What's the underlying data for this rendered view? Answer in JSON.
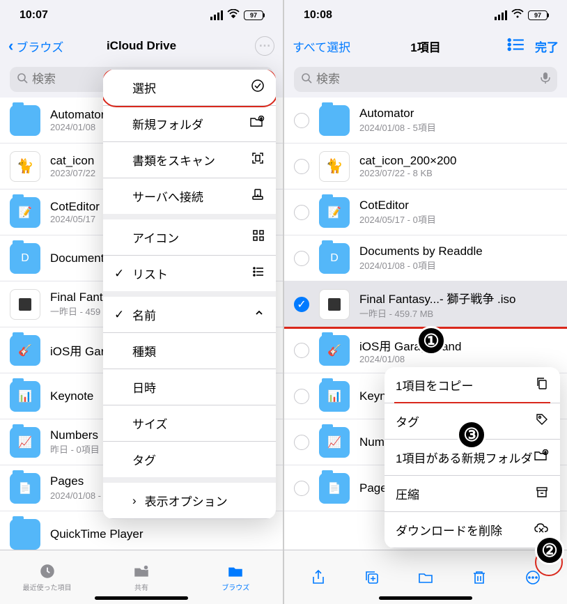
{
  "left": {
    "time": "10:07",
    "battery": "97",
    "nav": {
      "back": "ブラウズ",
      "title": "iCloud Drive"
    },
    "search_placeholder": "検索",
    "rows": [
      {
        "icon": "folder",
        "name": "Automator",
        "meta": "2024/01/08"
      },
      {
        "icon": "image",
        "name": "cat_icon",
        "meta": "2023/07/22"
      },
      {
        "icon": "folder-green",
        "name": "CotEditor",
        "meta": "2024/05/17"
      },
      {
        "icon": "folder-d",
        "name": "Documents",
        "meta": ""
      },
      {
        "icon": "file",
        "name": "Final Fantasy",
        "meta": "一昨日 - 459"
      },
      {
        "icon": "folder-gb",
        "name": "iOS用 GarageBand",
        "meta": ""
      },
      {
        "icon": "folder-key",
        "name": "Keynote",
        "meta": ""
      },
      {
        "icon": "folder-num",
        "name": "Numbers",
        "meta": "昨日 - 0項目"
      },
      {
        "icon": "folder-pages",
        "name": "Pages",
        "meta": "2024/01/08 - 0項目"
      },
      {
        "icon": "folder",
        "name": "QuickTime Player",
        "meta": ""
      }
    ],
    "menu": [
      {
        "label": "選択",
        "icon": "check-circle",
        "highlight": true
      },
      {
        "label": "新規フォルダ",
        "icon": "folder-plus"
      },
      {
        "label": "書類をスキャン",
        "icon": "scan"
      },
      {
        "label": "サーバへ接続",
        "icon": "server",
        "group_end": true
      },
      {
        "label": "アイコン",
        "icon": "grid",
        "check": ""
      },
      {
        "label": "リスト",
        "icon": "list",
        "check": "✓",
        "group_end": true
      },
      {
        "label": "名前",
        "icon": "chevron-up",
        "check": "✓"
      },
      {
        "label": "種類"
      },
      {
        "label": "日時"
      },
      {
        "label": "サイズ"
      },
      {
        "label": "タグ",
        "group_end": true
      },
      {
        "label": "表示オプション",
        "chevron": true
      }
    ],
    "tabs": [
      {
        "label": "最近使った項目"
      },
      {
        "label": "共有"
      },
      {
        "label": "ブラウズ",
        "active": true
      }
    ]
  },
  "right": {
    "time": "10:08",
    "battery": "97",
    "nav": {
      "select_all": "すべて選択",
      "title": "1項目",
      "done": "完了"
    },
    "search_placeholder": "検索",
    "rows": [
      {
        "name": "Automator",
        "meta": "2024/01/08 - 5項目",
        "icon": "folder"
      },
      {
        "name": "cat_icon_200×200",
        "meta": "2023/07/22 - 8 KB",
        "icon": "image"
      },
      {
        "name": "CotEditor",
        "meta": "2024/05/17 - 0項目",
        "icon": "folder-green"
      },
      {
        "name": "Documents by Readdle",
        "meta": "2024/01/08 - 0項目",
        "icon": "folder-d"
      },
      {
        "name": "Final Fantasy...- 獅子戦争 .iso",
        "meta": "一昨日 - 459.7 MB",
        "icon": "file",
        "selected": true
      },
      {
        "name": "iOS用 GarageBand",
        "meta": "2024/01/08",
        "icon": "folder-gb"
      },
      {
        "name": "Keynote",
        "meta": "",
        "icon": "folder-key"
      },
      {
        "name": "Numbers",
        "meta": "",
        "icon": "folder-num"
      },
      {
        "name": "Pages",
        "meta": "",
        "icon": "folder-pages"
      }
    ],
    "context": [
      {
        "label": "1項目をコピー",
        "icon": "copy",
        "underline": true
      },
      {
        "label": "タグ",
        "icon": "tag"
      },
      {
        "label": "1項目がある新規フォルダ",
        "icon": "folder-plus"
      },
      {
        "label": "圧縮",
        "icon": "archive"
      },
      {
        "label": "ダウンロードを削除",
        "icon": "cloud-x"
      }
    ],
    "badges": {
      "b1": "①",
      "b2": "②",
      "b3": "③"
    }
  }
}
